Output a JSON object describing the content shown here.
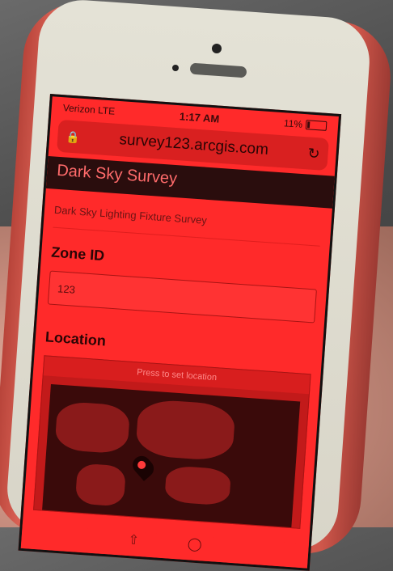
{
  "status": {
    "carrier": "Verizon",
    "network": "LTE",
    "time": "1:17 AM",
    "battery": "11%"
  },
  "browser": {
    "url": "survey123.arcgis.com",
    "lock_icon": "lock-icon",
    "reload_icon": "reload-icon"
  },
  "app": {
    "title": "Dark Sky Survey",
    "subtitle": "Dark Sky Lighting Fixture Survey"
  },
  "form": {
    "zone_label": "Zone ID",
    "zone_placeholder": "123",
    "location_label": "Location",
    "map_header": "Press to set location"
  },
  "colors": {
    "screen": "#ff2a2a",
    "titlebar": "#2a0d0d",
    "case": "#d85a4c"
  }
}
